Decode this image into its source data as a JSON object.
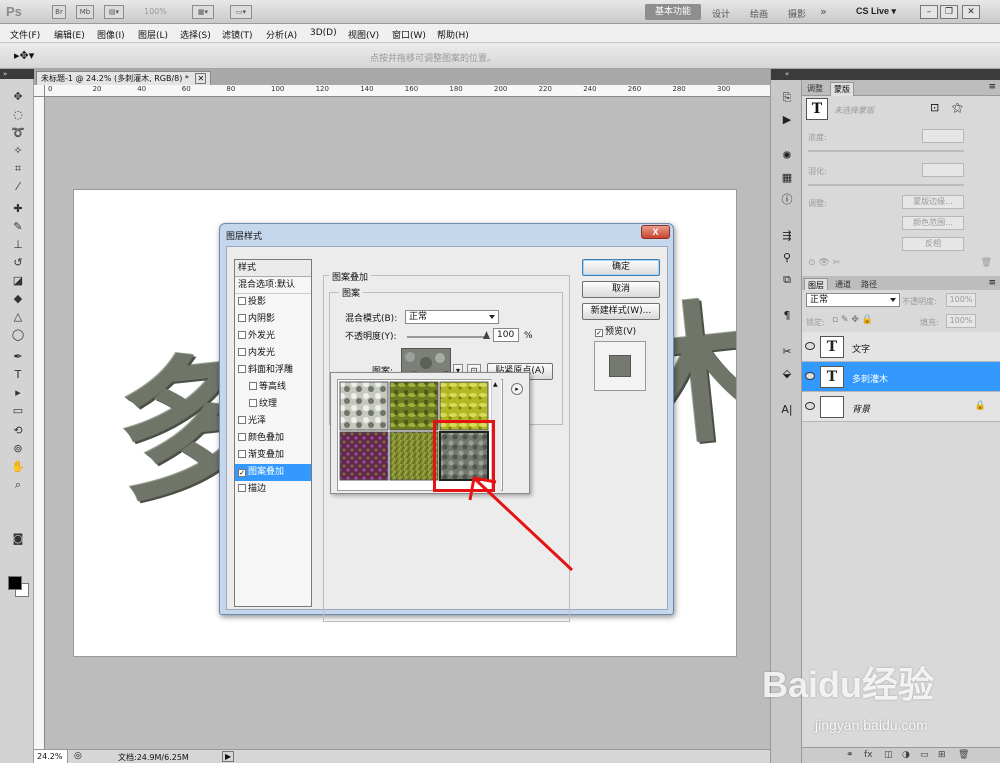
{
  "app": {
    "logo": "Ps",
    "zoom_display": "100%",
    "workspaces": [
      "基本功能",
      "设计",
      "绘画",
      "摄影"
    ],
    "more": "»",
    "cslive": "CS Live ▾"
  },
  "menu": [
    "文件(F)",
    "编辑(E)",
    "图像(I)",
    "图层(L)",
    "选择(S)",
    "滤镜(T)",
    "分析(A)",
    "3D(D)",
    "视图(V)",
    "窗口(W)",
    "帮助(H)"
  ],
  "options_hint": "点按并拖移可调整图案的位置。",
  "document": {
    "tab_title": "未标题-1 @ 24.2% (多刺灌木, RGB/8) *",
    "canvas_text": "多刺灌木",
    "ruler_labels": [
      "0",
      "20",
      "40",
      "60",
      "80",
      "100",
      "120",
      "140",
      "160",
      "180",
      "200",
      "220",
      "240",
      "260",
      "280",
      "300"
    ],
    "status_zoom": "24.2%",
    "status_doc": "文档:24.9M/6.25M"
  },
  "dialog": {
    "title": "图层样式",
    "close": "X",
    "style_list_header": "样式",
    "blend_row": "混合选项:默认",
    "styles": [
      {
        "label": "投影",
        "checked": false,
        "indent": false
      },
      {
        "label": "内阴影",
        "checked": false,
        "indent": false
      },
      {
        "label": "外发光",
        "checked": false,
        "indent": false
      },
      {
        "label": "内发光",
        "checked": false,
        "indent": false
      },
      {
        "label": "斜面和浮雕",
        "checked": false,
        "indent": false
      },
      {
        "label": "等高线",
        "checked": false,
        "indent": true
      },
      {
        "label": "纹理",
        "checked": false,
        "indent": true
      },
      {
        "label": "光泽",
        "checked": false,
        "indent": false
      },
      {
        "label": "颜色叠加",
        "checked": false,
        "indent": false
      },
      {
        "label": "渐变叠加",
        "checked": false,
        "indent": false
      },
      {
        "label": "图案叠加",
        "checked": true,
        "indent": false,
        "selected": true
      },
      {
        "label": "描边",
        "checked": false,
        "indent": false
      }
    ],
    "section_title": "图案叠加",
    "group_title": "图案",
    "blend_mode_label": "混合模式(B):",
    "blend_mode_value": "正常",
    "opacity_label": "不透明度(Y):",
    "opacity_value": "100",
    "opacity_unit": "%",
    "opacity_fraction": 1.0,
    "pattern_label": "图案:",
    "snap_button": "贴紧原点(A)",
    "ok": "确定",
    "cancel": "取消",
    "new_style": "新建样式(W)...",
    "preview_label": "预览(V)",
    "preview_checked": true
  },
  "pattern_picker": {
    "tiles": [
      "light-gravel",
      "green-leaves",
      "yellow-leaves",
      "purple-flowers",
      "grass",
      "gray-stone"
    ],
    "selected_tile": "gray-stone"
  },
  "panels": {
    "adjust_tabs": [
      "调整",
      "蒙版"
    ],
    "mask_hint": "未选择蒙版",
    "density_label": "浓度:",
    "feather_label": "羽化:",
    "refine_label": "调整:",
    "refine_buttons": [
      "蒙版边缘...",
      "颜色范围...",
      "反相"
    ],
    "layer_tabs": [
      "图层",
      "通道",
      "路径"
    ],
    "blend_mode": "正常",
    "opacity_label": "不透明度:",
    "opacity_value": "100%",
    "lock_label": "锁定:",
    "fill_label": "填充:",
    "fill_value": "100%",
    "layers": [
      {
        "name": "文字",
        "type": "text",
        "selected": false
      },
      {
        "name": "多刺灌木",
        "type": "text",
        "selected": true
      },
      {
        "name": "背景",
        "type": "background",
        "selected": false,
        "locked": true
      }
    ]
  },
  "watermark": {
    "brand": "Baidu经验",
    "url": "jingyan.baidu.com"
  }
}
